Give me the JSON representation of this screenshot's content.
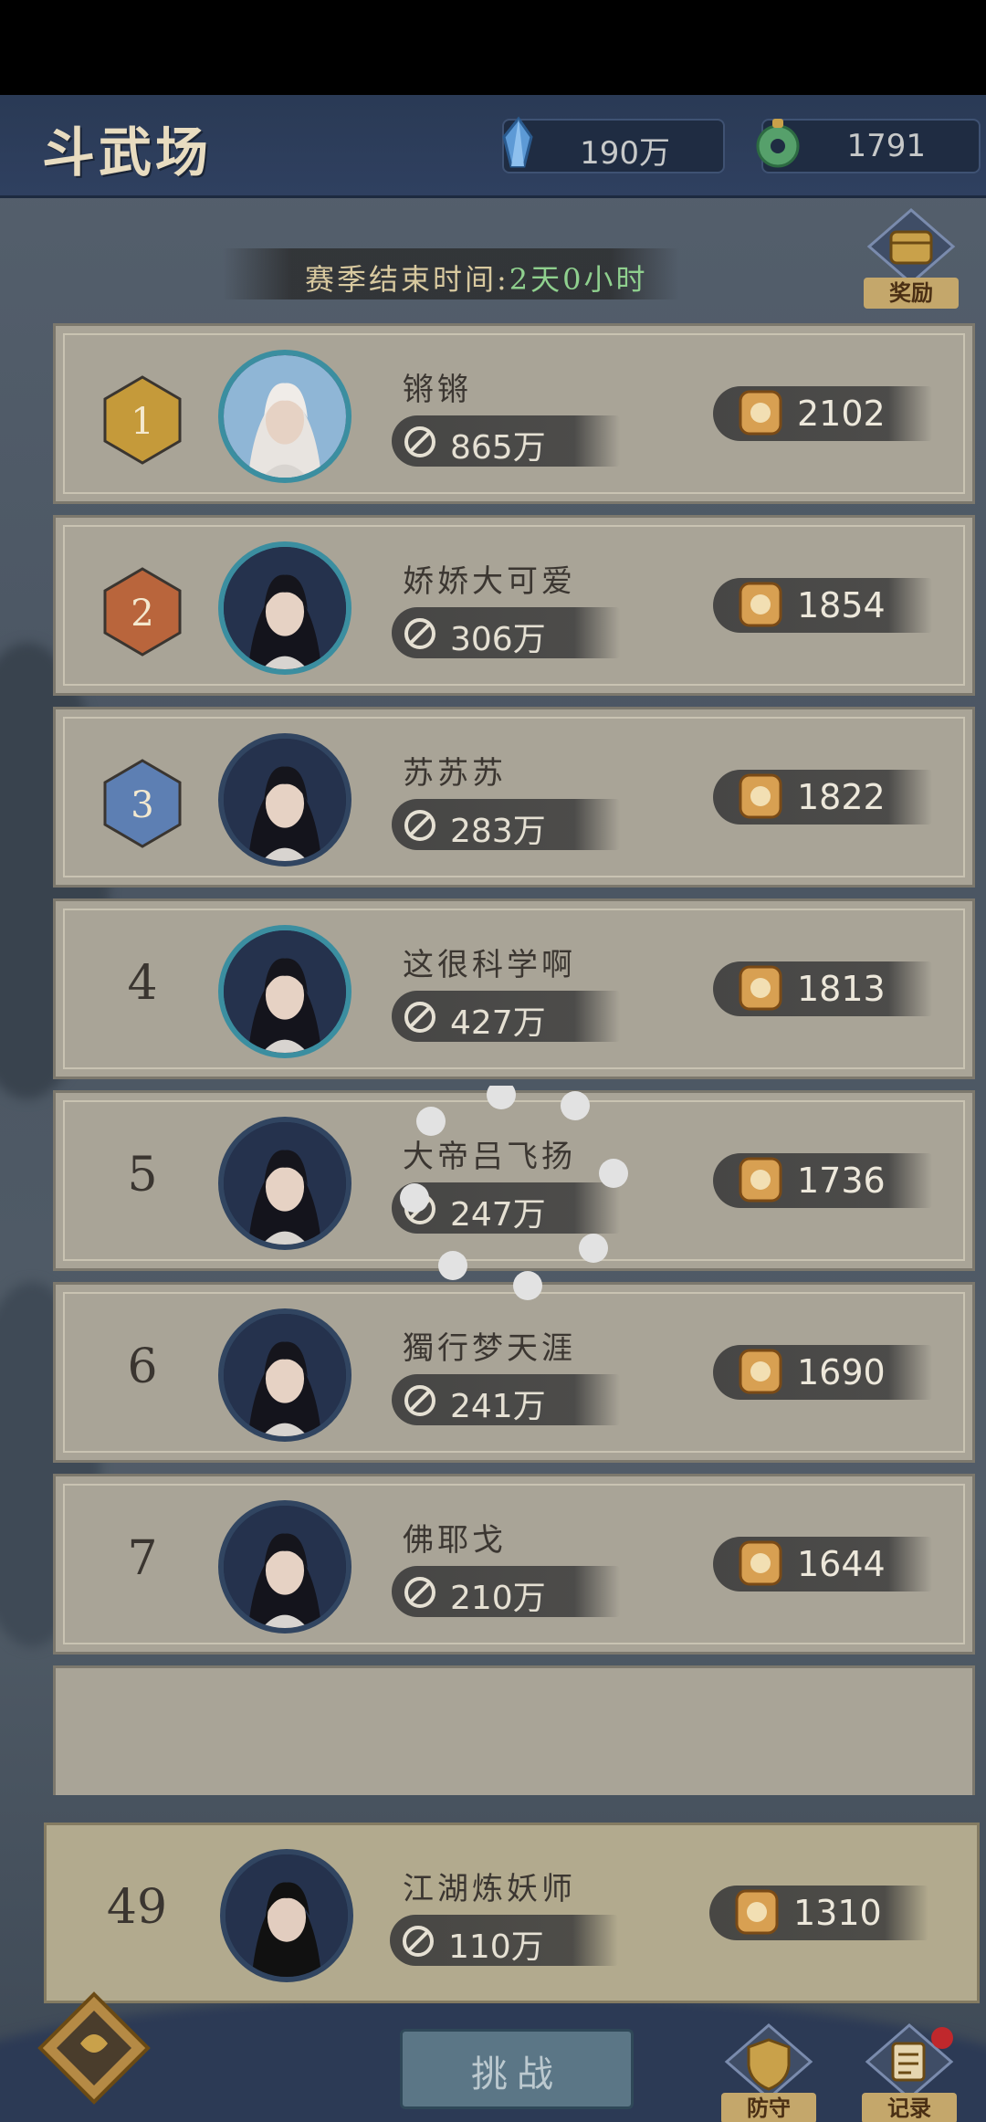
{
  "header": {
    "title": "斗武场",
    "resource_1": "190万",
    "resource_2": "1791"
  },
  "season": {
    "label": "赛季结束时间:",
    "value": "2天0小时"
  },
  "reward_label": "奖励",
  "ranking": [
    {
      "rank": "1",
      "name": "锵锵",
      "power": "865万",
      "score": "2102"
    },
    {
      "rank": "2",
      "name": "娇娇大可爱",
      "power": "306万",
      "score": "1854"
    },
    {
      "rank": "3",
      "name": "苏苏苏",
      "power": "283万",
      "score": "1822"
    },
    {
      "rank": "4",
      "name": "这很科学啊",
      "power": "427万",
      "score": "1813"
    },
    {
      "rank": "5",
      "name": "大帝吕飞扬",
      "power": "247万",
      "score": "1736"
    },
    {
      "rank": "6",
      "name": "獨行梦天涯",
      "power": "241万",
      "score": "1690"
    },
    {
      "rank": "7",
      "name": "佛耶戈",
      "power": "210万",
      "score": "1644"
    }
  ],
  "me": {
    "rank": "49",
    "name": "江湖炼妖师",
    "power": "110万",
    "score": "1310"
  },
  "buttons": {
    "challenge": "挑战",
    "defense": "防守",
    "record": "记录"
  },
  "colors": {
    "medal_gold": "#c59a3a",
    "medal_silver": "#b9653c",
    "medal_bronze": "#5d7fb3",
    "season_value": "#8fd08e",
    "notification_dot": "#c0282c"
  }
}
